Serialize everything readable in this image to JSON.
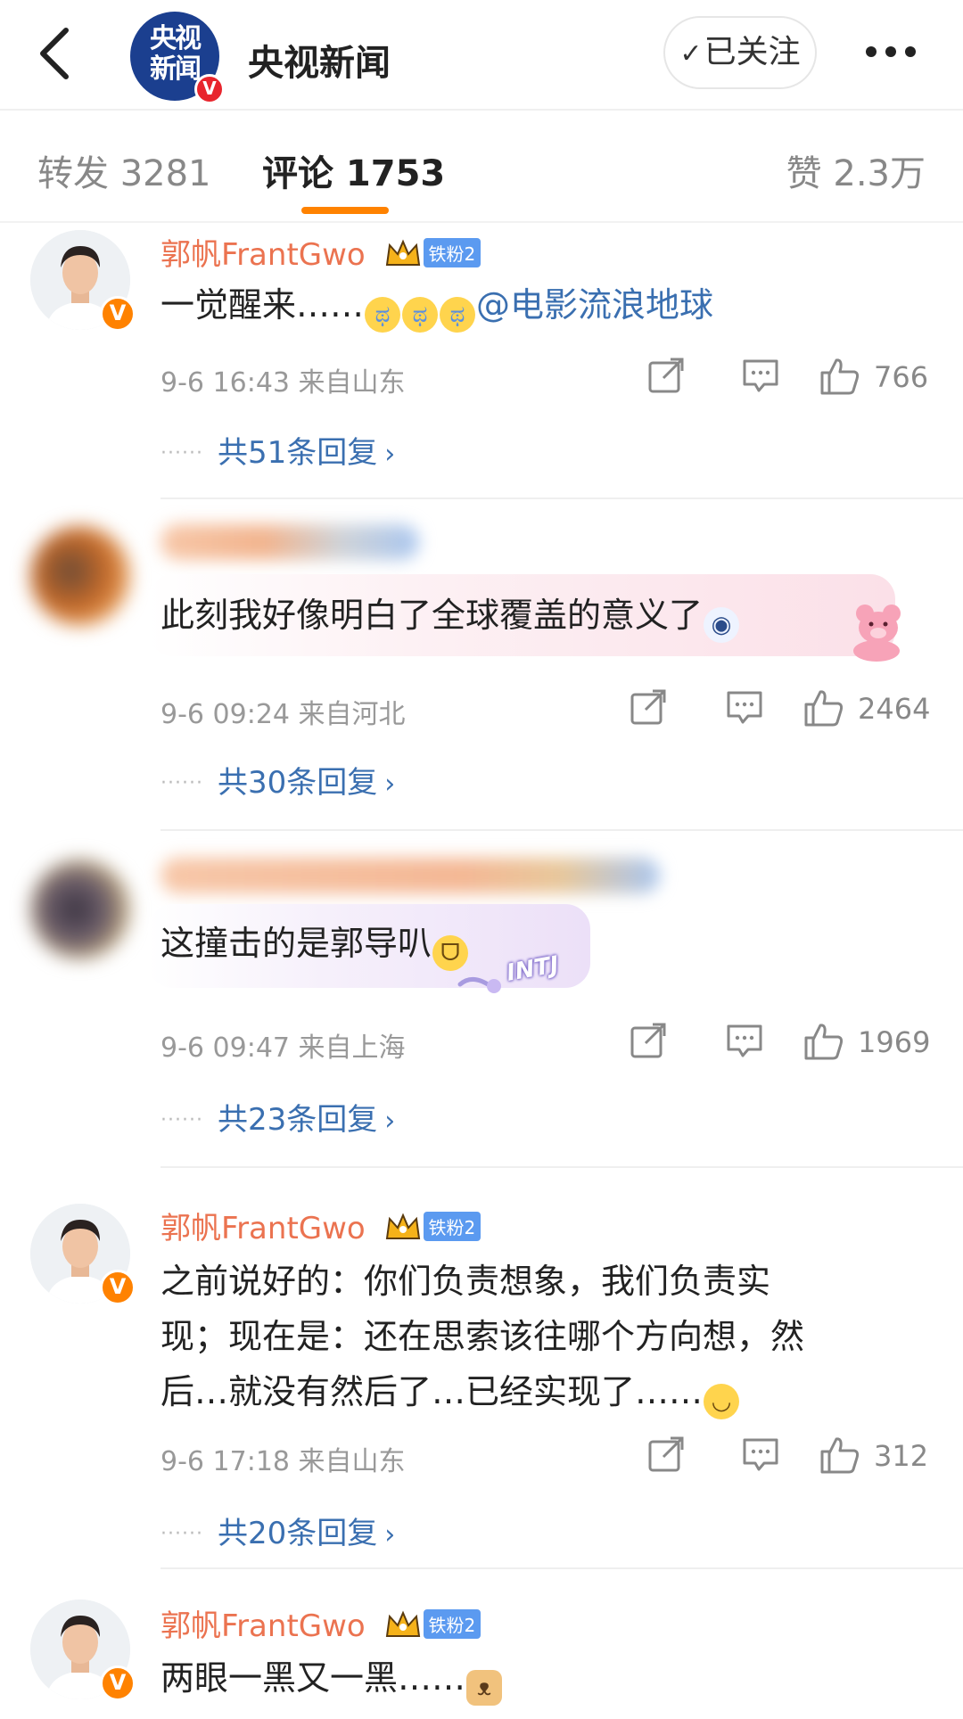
{
  "header": {
    "account_name": "央视新闻",
    "logo_text": "央视新闻",
    "follow_label": "已关注",
    "verified_label": "V"
  },
  "tabs": {
    "repost": "转发 3281",
    "comments": "评论 1753",
    "likes": "赞 2.3万"
  },
  "colors": {
    "accent": "#ff8200",
    "username": "#eb7350",
    "link": "#3a6fb0",
    "fan_badge": "#5b9af0"
  },
  "comments": [
    {
      "username": "郭帆FrantGwo",
      "fan_badge": "铁粉2",
      "text": "一觉醒来……",
      "mention": "@电影流浪地球",
      "time_location": "9-6 16:43 来自山东",
      "likes": "766",
      "replies": "共51条回复",
      "emojis": [
        "crying-laughing-icon",
        "crying-laughing-icon",
        "crying-laughing-icon"
      ]
    },
    {
      "username": "",
      "text": "此刻我好像明白了全球覆盖的意义了",
      "time_location": "9-6 09:24 来自河北",
      "likes": "2464",
      "replies": "共30条回复",
      "emojis": [
        "panda-face-icon"
      ]
    },
    {
      "username": "",
      "text": "这撞击的是郭导叭",
      "time_location": "9-6 09:47 来自上海",
      "likes": "1969",
      "replies": "共23条回复",
      "bubble_decoration": "INTJ",
      "emojis": [
        "laughing-icon"
      ]
    },
    {
      "username": "郭帆FrantGwo",
      "fan_badge": "铁粉2",
      "text_lines": [
        "之前说好的：你们负责想象，我们负责实",
        "现；现在是：还在思索该往哪个方向想，然",
        "后…就没有然后了…已经实现了……"
      ],
      "time_location": "9-6 17:18 来自山东",
      "likes": "312",
      "replies": "共20条回复",
      "emojis": [
        "smile-icon"
      ]
    },
    {
      "username": "郭帆FrantGwo",
      "fan_badge": "铁粉2",
      "text": "两眼一黑又一黑……",
      "emojis": [
        "doge-icon"
      ]
    }
  ]
}
